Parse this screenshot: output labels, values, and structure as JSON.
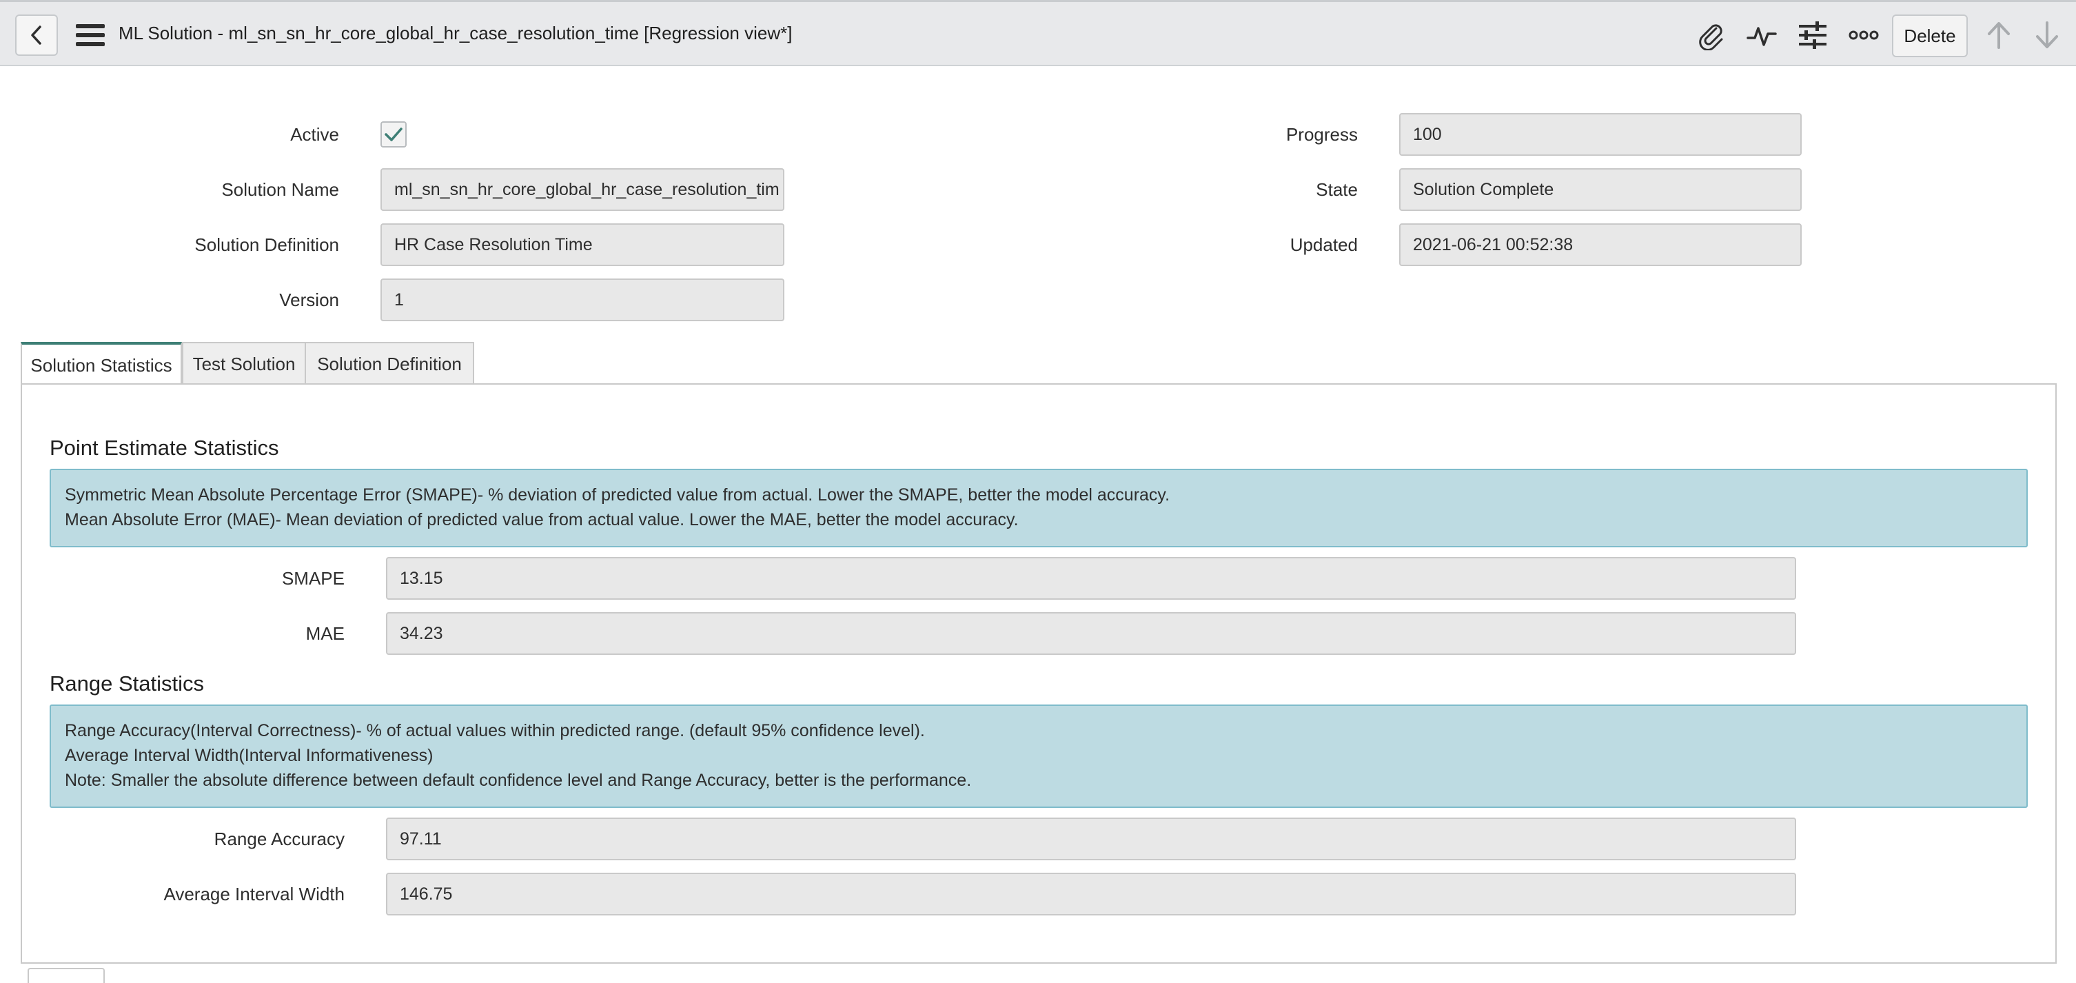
{
  "header": {
    "title_main": "ML Solution - ml_sn_sn_hr_core_global_hr_case_resolution_time",
    "title_view": "[Regression view*]",
    "delete_label": "Delete",
    "icons": [
      "back-icon",
      "menu-icon",
      "attachment-icon",
      "activity-icon",
      "settings-sliders-icon",
      "more-options-icon",
      "up-arrow-icon",
      "down-arrow-icon"
    ]
  },
  "form": {
    "active_label": "Active",
    "active_checked": true,
    "solution_name_label": "Solution Name",
    "solution_name_value": "ml_sn_sn_hr_core_global_hr_case_resolution_tim",
    "solution_definition_label": "Solution Definition",
    "solution_definition_value": "HR Case Resolution Time",
    "version_label": "Version",
    "version_value": "1",
    "progress_label": "Progress",
    "progress_value": "100",
    "state_label": "State",
    "state_value": "Solution Complete",
    "updated_label": "Updated",
    "updated_value": "2021-06-21 00:52:38"
  },
  "tabs": [
    {
      "label": "Solution Statistics",
      "active": true
    },
    {
      "label": "Test Solution",
      "active": false
    },
    {
      "label": "Solution Definition",
      "active": false
    }
  ],
  "point_estimate": {
    "title": "Point Estimate Statistics",
    "info_line1": "Symmetric Mean Absolute Percentage Error (SMAPE)- % deviation of predicted value from actual. Lower the SMAPE, better the model accuracy.",
    "info_line2": "Mean Absolute Error (MAE)- Mean deviation of predicted value from actual value. Lower the MAE, better the model accuracy.",
    "smape_label": "SMAPE",
    "smape_value": "13.15",
    "mae_label": "MAE",
    "mae_value": "34.23"
  },
  "range_stats": {
    "title": "Range Statistics",
    "info_line1": "Range Accuracy(Interval Correctness)- % of actual values within predicted range. (default 95% confidence level).",
    "info_line2": "Average Interval Width(Interval Informativeness)",
    "info_line3": "Note: Smaller the absolute difference between default confidence level and Range Accuracy, better is the performance.",
    "range_accuracy_label": "Range Accuracy",
    "range_accuracy_value": "97.11",
    "avg_interval_width_label": "Average Interval Width",
    "avg_interval_width_value": "146.75"
  },
  "colors": {
    "info_bg": "#bddbe2",
    "info_border": "#7fbccb",
    "tab_accent": "#3e7f76",
    "check": "#3e7f76"
  }
}
